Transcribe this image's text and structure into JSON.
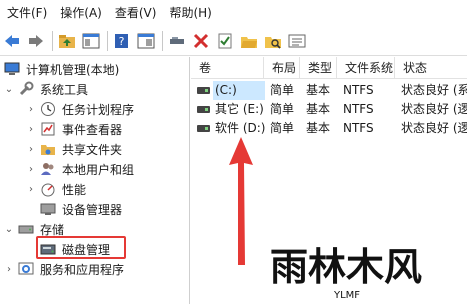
{
  "menu": [
    "文件(F)",
    "操作(A)",
    "查看(V)",
    "帮助(H)"
  ],
  "toolbar_icons": [
    "back-arrow-icon",
    "forward-arrow-icon",
    "folder-up-icon",
    "console-tree-icon",
    "help-icon",
    "properties-pane-icon",
    "connect-icon",
    "delete-icon",
    "check-icon",
    "open-folder-icon",
    "search-folder-icon",
    "list-view-icon"
  ],
  "tree": {
    "root": "计算机管理(本地)",
    "system_tools": "系统工具",
    "items": [
      "任务计划程序",
      "事件查看器",
      "共享文件夹",
      "本地用户和组",
      "性能",
      "设备管理器"
    ],
    "storage": "存储",
    "disk_mgmt": "磁盘管理",
    "services": "服务和应用程序"
  },
  "list": {
    "columns": [
      "卷",
      "布局",
      "类型",
      "文件系统",
      "状态"
    ],
    "rows": [
      [
        "(C:)",
        "简单",
        "基本",
        "NTFS",
        "状态良好 (系"
      ],
      [
        "其它 (E:)",
        "简单",
        "基本",
        "NTFS",
        "状态良好 (逻"
      ],
      [
        "软件 (D:)",
        "简单",
        "基本",
        "NTFS",
        "状态良好 (逻"
      ]
    ]
  },
  "watermark": {
    "main": "雨林木风",
    "sub": "YLMF"
  },
  "colors": {
    "arrow": "#e53935",
    "highlight_box": "#e53935",
    "selection": "#cce8ff"
  }
}
